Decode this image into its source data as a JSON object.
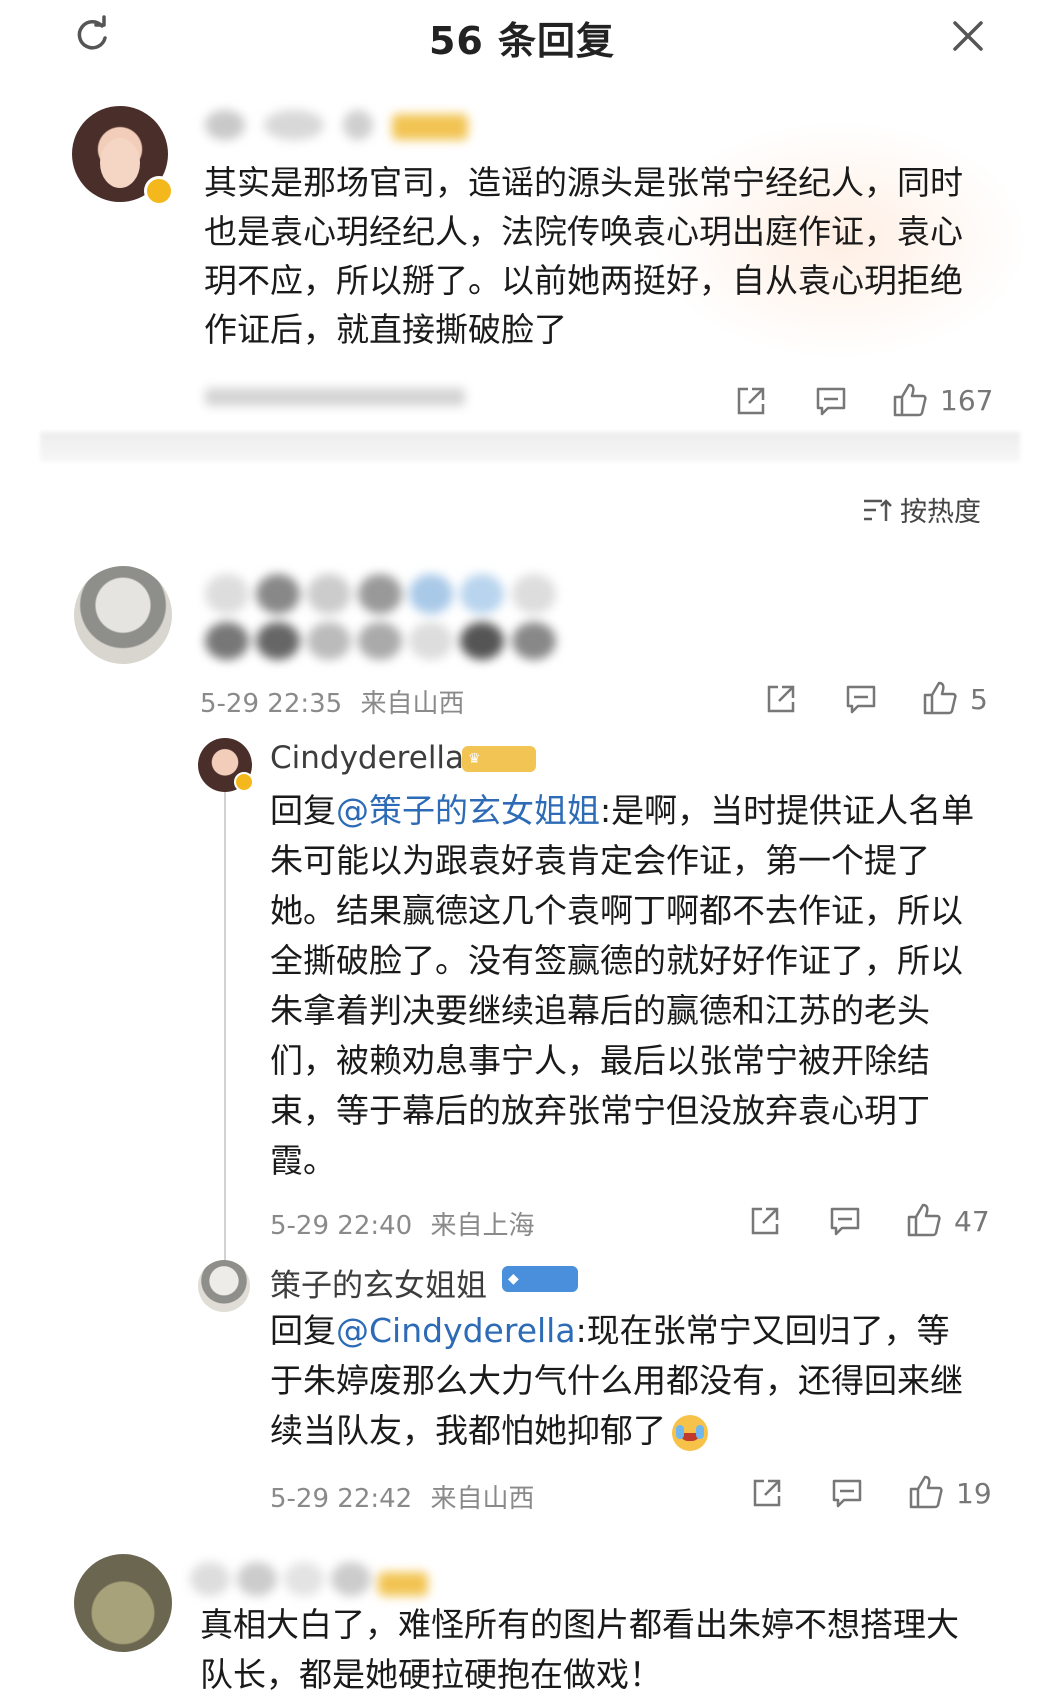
{
  "header": {
    "title": "56 条回复",
    "refresh_icon": "refresh-icon",
    "close_icon": "close-icon"
  },
  "main_comment": {
    "text": "其实是那场官司，造谣的源头是张常宁经纪人，同时也是袁心玥经纪人，法院传唤袁心玥出庭作证，袁心玥不应，所以掰了。以前她两挺好，自从袁心玥拒绝作证后，就直接撕破脸了",
    "like_count": "167"
  },
  "sort": {
    "label": "按热度"
  },
  "comments": [
    {
      "timestamp": "5-29 22:35",
      "location": "来自山西",
      "like_count": "5",
      "replies": [
        {
          "username": "Cindyderella",
          "reply_prefix": "回复",
          "mention": "@策子的玄女姐姐",
          "text": ":是啊，当时提供证人名单朱可能以为跟袁好袁肯定会作证，第一个提了她。结果赢德这几个袁啊丁啊都不去作证，所以全撕破脸了。没有签赢德的就好好作证了，所以朱拿着判决要继续追幕后的赢德和江苏的老头们，被赖劝息事宁人，最后以张常宁被开除结束，等于幕后的放弃张常宁但没放弃袁心玥丁霞。",
          "timestamp": "5-29 22:40",
          "location": "来自上海",
          "like_count": "47"
        },
        {
          "username": "策子的玄女姐姐",
          "reply_prefix": "回复",
          "mention": "@Cindyderella",
          "text": ":现在张常宁又回归了，等于朱婷废那么大力气什么用都没有，还得回来继续当队友，我都怕她抑郁了",
          "timestamp": "5-29 22:42",
          "location": "来自山西",
          "like_count": "19"
        }
      ]
    },
    {
      "text": "真相大白了，难怪所有的图片都看出朱婷不想搭理大队长，都是她硬拉硬抱在做戏！"
    }
  ],
  "colors": {
    "mention": "#2d6bb6",
    "meta": "#8a8a8a",
    "badge_gold": "#f5b81c",
    "badge_blue": "#4a8fdc"
  }
}
